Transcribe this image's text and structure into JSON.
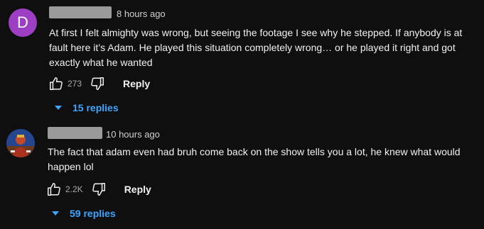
{
  "comments": [
    {
      "avatar_letter": "D",
      "avatar_color": "#9c3fc4",
      "timestamp": "8 hours ago",
      "text": "At first I felt almighty was wrong, but seeing the footage I see why he stepped. If anybody is at fault here it’s Adam. He played this situation completely wrong… or he played it right and got exactly what he wanted",
      "likes": "273",
      "reply_label": "Reply",
      "replies_label": "15 replies"
    },
    {
      "avatar_icon": "profile-photo",
      "timestamp": "10 hours ago",
      "text": "The fact that adam even had bruh come back on the show tells you a lot, he knew what would happen lol",
      "likes": "2.2K",
      "reply_label": "Reply",
      "replies_label": "59 replies"
    }
  ],
  "colors": {
    "background": "#0f0f0f",
    "text": "#f1f1f1",
    "secondary_text": "#aaaaaa",
    "accent_link": "#3ea6ff"
  }
}
